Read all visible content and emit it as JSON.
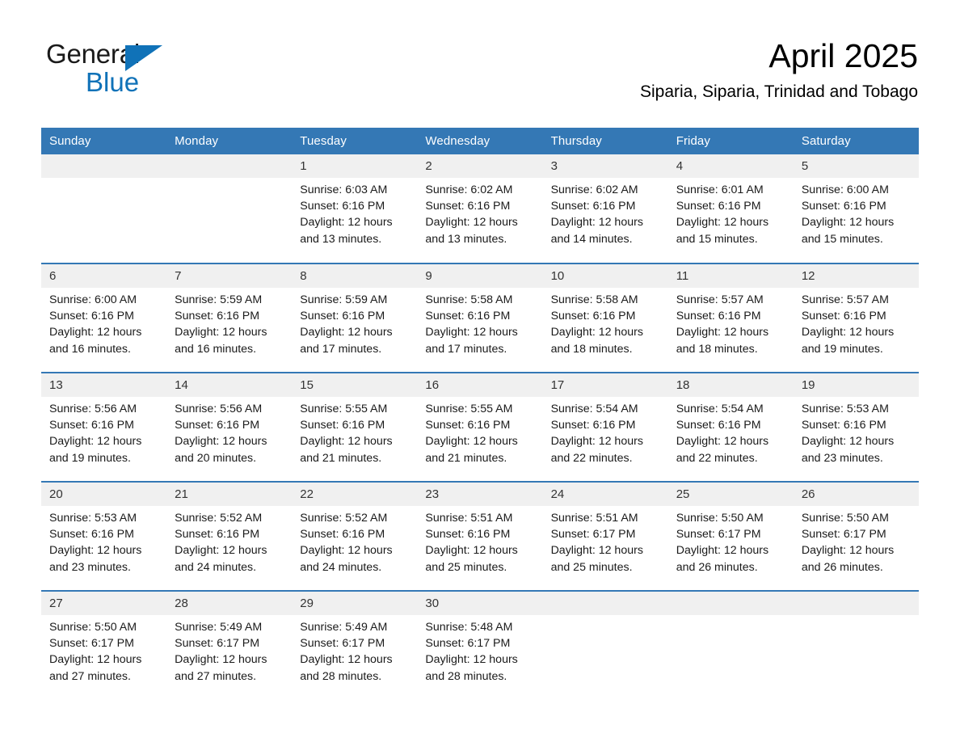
{
  "brand": {
    "name_part1": "General",
    "name_part2": "Blue",
    "triangle_color": "#1072b8",
    "accent_color": "#3478b5"
  },
  "header": {
    "title": "April 2025",
    "location": "Siparia, Siparia, Trinidad and Tobago"
  },
  "calendar": {
    "weekday_headers": [
      "Sunday",
      "Monday",
      "Tuesday",
      "Wednesday",
      "Thursday",
      "Friday",
      "Saturday"
    ],
    "weeks": [
      [
        {
          "day": "",
          "sunrise": "",
          "sunset": "",
          "daylight": "",
          "empty": true
        },
        {
          "day": "",
          "sunrise": "",
          "sunset": "",
          "daylight": "",
          "empty": true
        },
        {
          "day": "1",
          "sunrise": "Sunrise: 6:03 AM",
          "sunset": "Sunset: 6:16 PM",
          "daylight": "Daylight: 12 hours and 13 minutes."
        },
        {
          "day": "2",
          "sunrise": "Sunrise: 6:02 AM",
          "sunset": "Sunset: 6:16 PM",
          "daylight": "Daylight: 12 hours and 13 minutes."
        },
        {
          "day": "3",
          "sunrise": "Sunrise: 6:02 AM",
          "sunset": "Sunset: 6:16 PM",
          "daylight": "Daylight: 12 hours and 14 minutes."
        },
        {
          "day": "4",
          "sunrise": "Sunrise: 6:01 AM",
          "sunset": "Sunset: 6:16 PM",
          "daylight": "Daylight: 12 hours and 15 minutes."
        },
        {
          "day": "5",
          "sunrise": "Sunrise: 6:00 AM",
          "sunset": "Sunset: 6:16 PM",
          "daylight": "Daylight: 12 hours and 15 minutes."
        }
      ],
      [
        {
          "day": "6",
          "sunrise": "Sunrise: 6:00 AM",
          "sunset": "Sunset: 6:16 PM",
          "daylight": "Daylight: 12 hours and 16 minutes."
        },
        {
          "day": "7",
          "sunrise": "Sunrise: 5:59 AM",
          "sunset": "Sunset: 6:16 PM",
          "daylight": "Daylight: 12 hours and 16 minutes."
        },
        {
          "day": "8",
          "sunrise": "Sunrise: 5:59 AM",
          "sunset": "Sunset: 6:16 PM",
          "daylight": "Daylight: 12 hours and 17 minutes."
        },
        {
          "day": "9",
          "sunrise": "Sunrise: 5:58 AM",
          "sunset": "Sunset: 6:16 PM",
          "daylight": "Daylight: 12 hours and 17 minutes."
        },
        {
          "day": "10",
          "sunrise": "Sunrise: 5:58 AM",
          "sunset": "Sunset: 6:16 PM",
          "daylight": "Daylight: 12 hours and 18 minutes."
        },
        {
          "day": "11",
          "sunrise": "Sunrise: 5:57 AM",
          "sunset": "Sunset: 6:16 PM",
          "daylight": "Daylight: 12 hours and 18 minutes."
        },
        {
          "day": "12",
          "sunrise": "Sunrise: 5:57 AM",
          "sunset": "Sunset: 6:16 PM",
          "daylight": "Daylight: 12 hours and 19 minutes."
        }
      ],
      [
        {
          "day": "13",
          "sunrise": "Sunrise: 5:56 AM",
          "sunset": "Sunset: 6:16 PM",
          "daylight": "Daylight: 12 hours and 19 minutes."
        },
        {
          "day": "14",
          "sunrise": "Sunrise: 5:56 AM",
          "sunset": "Sunset: 6:16 PM",
          "daylight": "Daylight: 12 hours and 20 minutes."
        },
        {
          "day": "15",
          "sunrise": "Sunrise: 5:55 AM",
          "sunset": "Sunset: 6:16 PM",
          "daylight": "Daylight: 12 hours and 21 minutes."
        },
        {
          "day": "16",
          "sunrise": "Sunrise: 5:55 AM",
          "sunset": "Sunset: 6:16 PM",
          "daylight": "Daylight: 12 hours and 21 minutes."
        },
        {
          "day": "17",
          "sunrise": "Sunrise: 5:54 AM",
          "sunset": "Sunset: 6:16 PM",
          "daylight": "Daylight: 12 hours and 22 minutes."
        },
        {
          "day": "18",
          "sunrise": "Sunrise: 5:54 AM",
          "sunset": "Sunset: 6:16 PM",
          "daylight": "Daylight: 12 hours and 22 minutes."
        },
        {
          "day": "19",
          "sunrise": "Sunrise: 5:53 AM",
          "sunset": "Sunset: 6:16 PM",
          "daylight": "Daylight: 12 hours and 23 minutes."
        }
      ],
      [
        {
          "day": "20",
          "sunrise": "Sunrise: 5:53 AM",
          "sunset": "Sunset: 6:16 PM",
          "daylight": "Daylight: 12 hours and 23 minutes."
        },
        {
          "day": "21",
          "sunrise": "Sunrise: 5:52 AM",
          "sunset": "Sunset: 6:16 PM",
          "daylight": "Daylight: 12 hours and 24 minutes."
        },
        {
          "day": "22",
          "sunrise": "Sunrise: 5:52 AM",
          "sunset": "Sunset: 6:16 PM",
          "daylight": "Daylight: 12 hours and 24 minutes."
        },
        {
          "day": "23",
          "sunrise": "Sunrise: 5:51 AM",
          "sunset": "Sunset: 6:16 PM",
          "daylight": "Daylight: 12 hours and 25 minutes."
        },
        {
          "day": "24",
          "sunrise": "Sunrise: 5:51 AM",
          "sunset": "Sunset: 6:17 PM",
          "daylight": "Daylight: 12 hours and 25 minutes."
        },
        {
          "day": "25",
          "sunrise": "Sunrise: 5:50 AM",
          "sunset": "Sunset: 6:17 PM",
          "daylight": "Daylight: 12 hours and 26 minutes."
        },
        {
          "day": "26",
          "sunrise": "Sunrise: 5:50 AM",
          "sunset": "Sunset: 6:17 PM",
          "daylight": "Daylight: 12 hours and 26 minutes."
        }
      ],
      [
        {
          "day": "27",
          "sunrise": "Sunrise: 5:50 AM",
          "sunset": "Sunset: 6:17 PM",
          "daylight": "Daylight: 12 hours and 27 minutes."
        },
        {
          "day": "28",
          "sunrise": "Sunrise: 5:49 AM",
          "sunset": "Sunset: 6:17 PM",
          "daylight": "Daylight: 12 hours and 27 minutes."
        },
        {
          "day": "29",
          "sunrise": "Sunrise: 5:49 AM",
          "sunset": "Sunset: 6:17 PM",
          "daylight": "Daylight: 12 hours and 28 minutes."
        },
        {
          "day": "30",
          "sunrise": "Sunrise: 5:48 AM",
          "sunset": "Sunset: 6:17 PM",
          "daylight": "Daylight: 12 hours and 28 minutes."
        },
        {
          "day": "",
          "sunrise": "",
          "sunset": "",
          "daylight": "",
          "empty": true
        },
        {
          "day": "",
          "sunrise": "",
          "sunset": "",
          "daylight": "",
          "empty": true
        },
        {
          "day": "",
          "sunrise": "",
          "sunset": "",
          "daylight": "",
          "empty": true
        }
      ]
    ]
  }
}
